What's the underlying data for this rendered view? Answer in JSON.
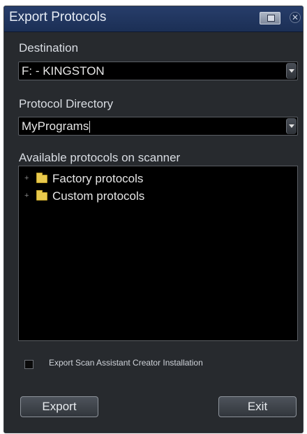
{
  "window": {
    "title": "Export Protocols"
  },
  "destination": {
    "label": "Destination",
    "value": "F: - KINGSTON"
  },
  "protocol_directory": {
    "label": "Protocol Directory",
    "value": "MyPrograms"
  },
  "protocols": {
    "label": "Available protocols on scanner",
    "items": [
      {
        "expander": "+",
        "icon": "folder-icon",
        "label": "Factory protocols"
      },
      {
        "expander": "+",
        "icon": "folder-icon",
        "label": "Custom protocols"
      }
    ]
  },
  "options": {
    "export_installation_label": "Export Scan Assistant Creator Installation",
    "export_installation_checked": false
  },
  "buttons": {
    "export": "Export",
    "exit": "Exit"
  },
  "titlebar_icons": {
    "restore": "restore-icon",
    "close": "close-icon"
  },
  "colors": {
    "titlebar": "#1f3560",
    "dialog": "#272a2e",
    "field": "#000000",
    "folder": "#e8c94d"
  }
}
